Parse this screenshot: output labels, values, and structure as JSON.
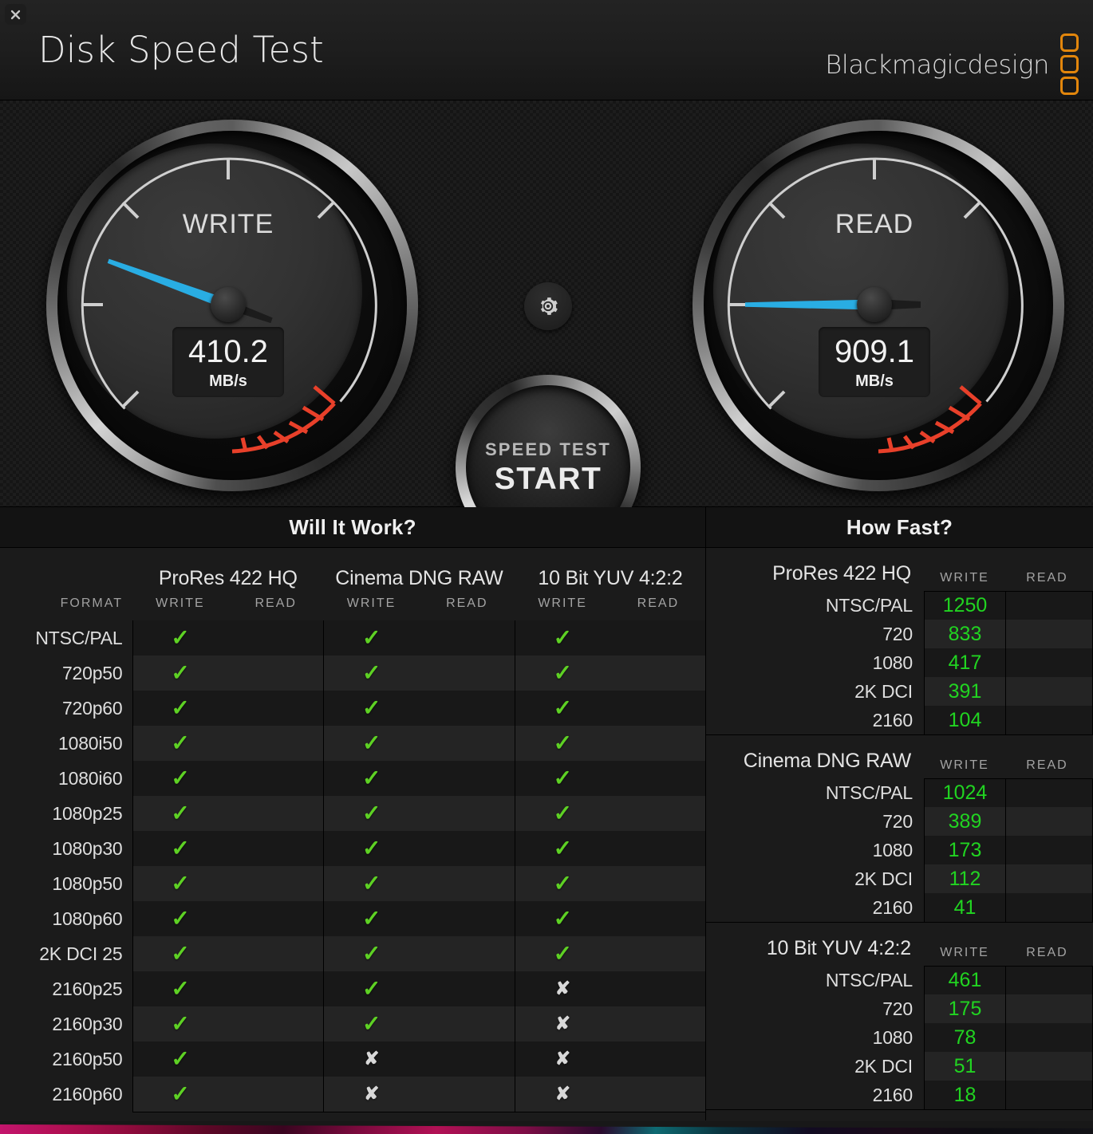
{
  "window": {
    "close_icon": "close-icon",
    "title": "Disk Speed Test",
    "brand": "Blackmagicdesign",
    "brand_color": "#e2860c"
  },
  "gauges": {
    "settings_icon": "gear-icon",
    "write": {
      "label": "WRITE",
      "value": "410.2",
      "unit": "MB/s",
      "needle_angle_deg": -160
    },
    "read": {
      "label": "READ",
      "value": "909.1",
      "unit": "MB/s",
      "needle_angle_deg": -180
    },
    "start_button": {
      "line1": "SPEED TEST",
      "line2": "START"
    },
    "needle_color": "#29ade3",
    "redline_color": "#e8402a"
  },
  "will_it_work": {
    "title": "Will It Work?",
    "format_header": "FORMAT",
    "codecs": [
      "ProRes 422 HQ",
      "Cinema DNG RAW",
      "10 Bit YUV 4:2:2"
    ],
    "sub_headers": [
      "WRITE",
      "READ"
    ],
    "pass_glyph": "✓",
    "fail_glyph": "✘",
    "pass_color": "#5ed124",
    "fail_color": "#d8d8d8",
    "rows": [
      {
        "format": "NTSC/PAL",
        "cells": [
          "pass",
          "",
          "pass",
          "",
          "pass",
          ""
        ]
      },
      {
        "format": "720p50",
        "cells": [
          "pass",
          "",
          "pass",
          "",
          "pass",
          ""
        ]
      },
      {
        "format": "720p60",
        "cells": [
          "pass",
          "",
          "pass",
          "",
          "pass",
          ""
        ]
      },
      {
        "format": "1080i50",
        "cells": [
          "pass",
          "",
          "pass",
          "",
          "pass",
          ""
        ]
      },
      {
        "format": "1080i60",
        "cells": [
          "pass",
          "",
          "pass",
          "",
          "pass",
          ""
        ]
      },
      {
        "format": "1080p25",
        "cells": [
          "pass",
          "",
          "pass",
          "",
          "pass",
          ""
        ]
      },
      {
        "format": "1080p30",
        "cells": [
          "pass",
          "",
          "pass",
          "",
          "pass",
          ""
        ]
      },
      {
        "format": "1080p50",
        "cells": [
          "pass",
          "",
          "pass",
          "",
          "pass",
          ""
        ]
      },
      {
        "format": "1080p60",
        "cells": [
          "pass",
          "",
          "pass",
          "",
          "pass",
          ""
        ]
      },
      {
        "format": "2K DCI 25",
        "cells": [
          "pass",
          "",
          "pass",
          "",
          "pass",
          ""
        ]
      },
      {
        "format": "2160p25",
        "cells": [
          "pass",
          "",
          "pass",
          "",
          "fail",
          ""
        ]
      },
      {
        "format": "2160p30",
        "cells": [
          "pass",
          "",
          "pass",
          "",
          "fail",
          ""
        ]
      },
      {
        "format": "2160p50",
        "cells": [
          "pass",
          "",
          "fail",
          "",
          "fail",
          ""
        ]
      },
      {
        "format": "2160p60",
        "cells": [
          "pass",
          "",
          "fail",
          "",
          "fail",
          ""
        ]
      }
    ]
  },
  "how_fast": {
    "title": "How Fast?",
    "column_headers": [
      "WRITE",
      "READ"
    ],
    "value_color": "#21d421",
    "groups": [
      {
        "name": "ProRes 422 HQ",
        "rows": [
          {
            "label": "NTSC/PAL",
            "write": "1250",
            "read": ""
          },
          {
            "label": "720",
            "write": "833",
            "read": ""
          },
          {
            "label": "1080",
            "write": "417",
            "read": ""
          },
          {
            "label": "2K DCI",
            "write": "391",
            "read": ""
          },
          {
            "label": "2160",
            "write": "104",
            "read": ""
          }
        ]
      },
      {
        "name": "Cinema DNG RAW",
        "rows": [
          {
            "label": "NTSC/PAL",
            "write": "1024",
            "read": ""
          },
          {
            "label": "720",
            "write": "389",
            "read": ""
          },
          {
            "label": "1080",
            "write": "173",
            "read": ""
          },
          {
            "label": "2K DCI",
            "write": "112",
            "read": ""
          },
          {
            "label": "2160",
            "write": "41",
            "read": ""
          }
        ]
      },
      {
        "name": "10 Bit YUV 4:2:2",
        "rows": [
          {
            "label": "NTSC/PAL",
            "write": "461",
            "read": ""
          },
          {
            "label": "720",
            "write": "175",
            "read": ""
          },
          {
            "label": "1080",
            "write": "78",
            "read": ""
          },
          {
            "label": "2K DCI",
            "write": "51",
            "read": ""
          },
          {
            "label": "2160",
            "write": "18",
            "read": ""
          }
        ]
      }
    ]
  }
}
